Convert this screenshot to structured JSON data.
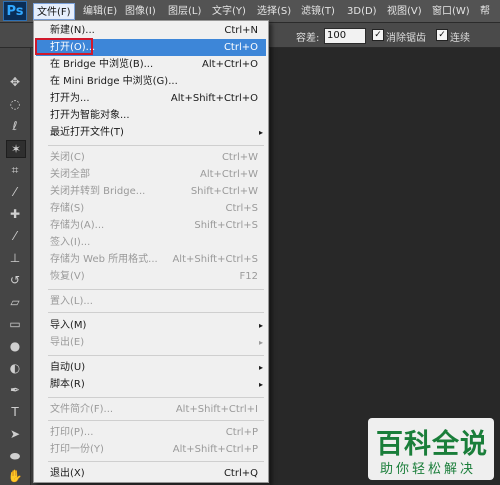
{
  "app_logo": "Ps",
  "menubar": {
    "items": [
      "文件(F)",
      "编辑(E)",
      "图像(I)",
      "图层(L)",
      "文字(Y)",
      "选择(S)",
      "滤镜(T)",
      "3D(D)",
      "视图(V)",
      "窗口(W)",
      "帮"
    ]
  },
  "options_bar": {
    "tolerance_label": "容差:",
    "tolerance_value": "100",
    "antialias_label": "消除锯齿",
    "contiguous_label": "连续",
    "antialias_checked": "✓",
    "contiguous_checked": "✓"
  },
  "file_menu": {
    "items": [
      {
        "label": "新建(N)...",
        "shortcut": "Ctrl+N"
      },
      {
        "label": "打开(O)...",
        "shortcut": "Ctrl+O"
      },
      {
        "label": "在 Bridge 中浏览(B)...",
        "shortcut": "Alt+Ctrl+O"
      },
      {
        "label": "在 Mini Bridge 中浏览(G)...",
        "shortcut": ""
      },
      {
        "label": "打开为...",
        "shortcut": "Alt+Shift+Ctrl+O"
      },
      {
        "label": "打开为智能对象...",
        "shortcut": ""
      },
      {
        "label": "最近打开文件(T)",
        "shortcut": "▸"
      },
      {
        "label": "关闭(C)",
        "shortcut": "Ctrl+W"
      },
      {
        "label": "关闭全部",
        "shortcut": "Alt+Ctrl+W"
      },
      {
        "label": "关闭并转到 Bridge...",
        "shortcut": "Shift+Ctrl+W"
      },
      {
        "label": "存储(S)",
        "shortcut": "Ctrl+S"
      },
      {
        "label": "存储为(A)...",
        "shortcut": "Shift+Ctrl+S"
      },
      {
        "label": "签入(I)...",
        "shortcut": ""
      },
      {
        "label": "存储为 Web 所用格式...",
        "shortcut": "Alt+Shift+Ctrl+S"
      },
      {
        "label": "恢复(V)",
        "shortcut": "F12"
      },
      {
        "label": "置入(L)...",
        "shortcut": ""
      },
      {
        "label": "导入(M)",
        "shortcut": "▸"
      },
      {
        "label": "导出(E)",
        "shortcut": "▸"
      },
      {
        "label": "自动(U)",
        "shortcut": "▸"
      },
      {
        "label": "脚本(R)",
        "shortcut": "▸"
      },
      {
        "label": "文件简介(F)...",
        "shortcut": "Alt+Shift+Ctrl+I"
      },
      {
        "label": "打印(P)...",
        "shortcut": "Ctrl+P"
      },
      {
        "label": "打印一份(Y)",
        "shortcut": "Alt+Shift+Ctrl+P"
      },
      {
        "label": "退出(X)",
        "shortcut": "Ctrl+Q"
      }
    ]
  },
  "toolbox": {
    "tools": [
      "move-tool-icon",
      "marquee-tool-icon",
      "lasso-tool-icon",
      "magic-wand-tool-icon",
      "crop-tool-icon",
      "eyedropper-tool-icon",
      "healing-brush-tool-icon",
      "brush-tool-icon",
      "clone-stamp-tool-icon",
      "history-brush-tool-icon",
      "eraser-tool-icon",
      "gradient-tool-icon",
      "blur-tool-icon",
      "dodge-tool-icon",
      "pen-tool-icon",
      "type-tool-icon",
      "path-selection-tool-icon",
      "ellipse-tool-icon",
      "hand-tool-icon"
    ]
  },
  "watermark": {
    "title": "百科全说",
    "subtitle": "助你轻松解决"
  },
  "colors": {
    "menu_highlight": "#3d86d8",
    "annotation_red": "#d0182b",
    "watermark_green": "#1a7e3a"
  }
}
